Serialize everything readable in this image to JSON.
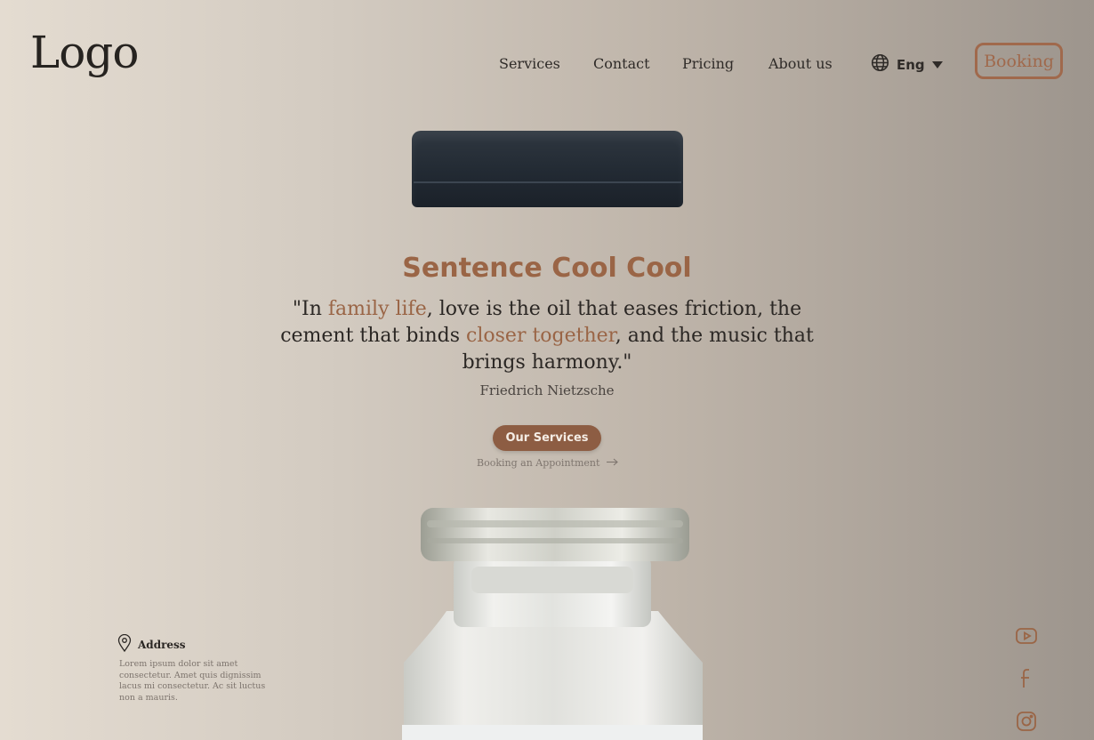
{
  "logo": "Logo",
  "nav": [
    {
      "label": "Services"
    },
    {
      "label": "Contact"
    },
    {
      "label": "Pricing"
    },
    {
      "label": "About us"
    }
  ],
  "language": {
    "label": "Eng",
    "icon": "globe-icon"
  },
  "booking_button": "Booking",
  "hero": {
    "headline": "Sentence Cool Cool",
    "quote": {
      "p1": "\"In ",
      "h1": "family life",
      "p2": ", love is the oil that eases friction, the cement that binds ",
      "h2": "closer together",
      "p3": ", and the music that brings harmony.\""
    },
    "author": "Friedrich Nietzsche",
    "cta_label": "Our Services",
    "link_label": "Booking an Appointment"
  },
  "address": {
    "title": "Address",
    "text": "Lorem ipsum dolor sit amet consectetur. Amet quis dignissim lacus mi consectetur. Ac sit luctus non a mauris."
  },
  "social": [
    {
      "name": "youtube-icon"
    },
    {
      "name": "facebook-icon"
    },
    {
      "name": "instagram-icon"
    }
  ],
  "colors": {
    "accent": "#9a6546",
    "button": "#8d5d43",
    "text": "#2b2724",
    "background_left": "#e4dcd1",
    "background_right": "#9d958d"
  }
}
